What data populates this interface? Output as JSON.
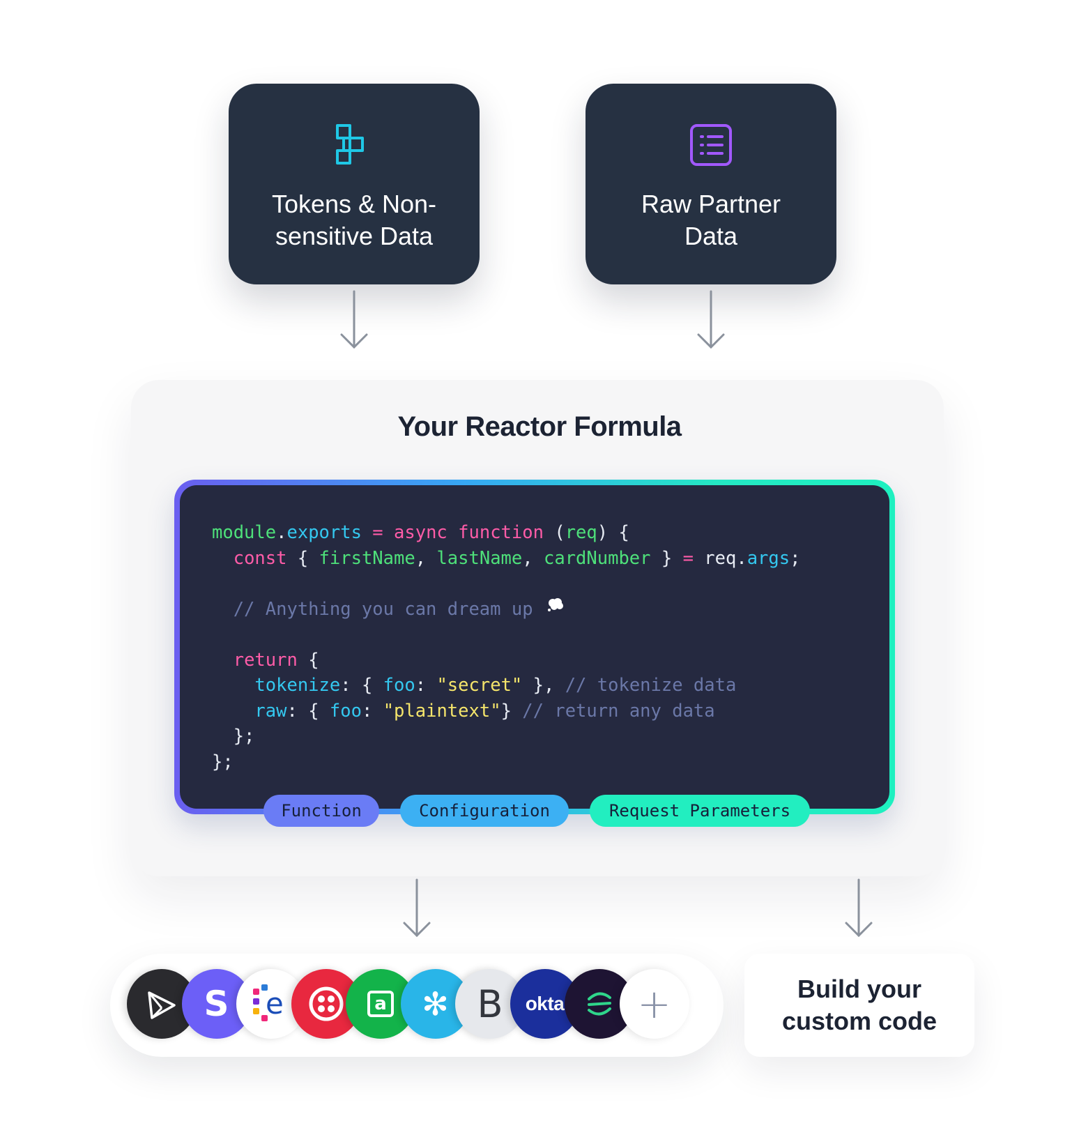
{
  "sources": {
    "tokens": {
      "title": "Tokens & Non-sensitive Data",
      "icon": "proxy-icon",
      "color": "#1fc8e6"
    },
    "raw": {
      "title": "Raw Partner Data",
      "icon": "list-icon",
      "color": "#a259ff"
    }
  },
  "formula": {
    "title": "Your Reactor Formula",
    "code": [
      [
        [
          "module",
          "g"
        ],
        [
          ".",
          "w"
        ],
        [
          "exports",
          "c"
        ],
        [
          " = ",
          "k"
        ],
        [
          "async",
          "k"
        ],
        [
          " ",
          "w"
        ],
        [
          "function",
          "k"
        ],
        [
          " (",
          "w"
        ],
        [
          "req",
          "g"
        ],
        [
          ") {",
          "w"
        ]
      ],
      [
        [
          "  ",
          "w"
        ],
        [
          "const",
          "k"
        ],
        [
          " { ",
          "w"
        ],
        [
          "firstName",
          "g"
        ],
        [
          ", ",
          "w"
        ],
        [
          "lastName",
          "g"
        ],
        [
          ", ",
          "w"
        ],
        [
          "cardNumber",
          "g"
        ],
        [
          " } ",
          "w"
        ],
        [
          "=",
          "k"
        ],
        [
          " req.",
          "w"
        ],
        [
          "args",
          "c"
        ],
        [
          ";",
          "w"
        ]
      ],
      [],
      [
        [
          "  // Anything you can dream up ",
          "cm"
        ]
      ],
      [],
      [
        [
          "  ",
          "w"
        ],
        [
          "return",
          "k"
        ],
        [
          " {",
          "w"
        ]
      ],
      [
        [
          "    ",
          "w"
        ],
        [
          "tokenize",
          "c"
        ],
        [
          ": { ",
          "w"
        ],
        [
          "foo",
          "c"
        ],
        [
          ": ",
          "w"
        ],
        [
          "\"secret\"",
          "s"
        ],
        [
          " }, ",
          "w"
        ],
        [
          "// tokenize data",
          "cm"
        ]
      ],
      [
        [
          "    ",
          "w"
        ],
        [
          "raw",
          "c"
        ],
        [
          ": { ",
          "w"
        ],
        [
          "foo",
          "c"
        ],
        [
          ": ",
          "w"
        ],
        [
          "\"plaintext\"",
          "s"
        ],
        [
          "} ",
          "w"
        ],
        [
          "// return any data",
          "cm"
        ]
      ],
      [
        [
          "  };",
          "w"
        ]
      ],
      [
        [
          "};",
          "w"
        ]
      ]
    ],
    "tags": [
      {
        "label": "Function",
        "color": "#6a7cf5"
      },
      {
        "label": "Configuration",
        "color": "#3cb0f3"
      },
      {
        "label": "Request Parameters",
        "color": "#22eec0"
      }
    ]
  },
  "integrations": {
    "logos": [
      {
        "name": "prisma-logo",
        "bg": "#2a2a2e",
        "text": ""
      },
      {
        "name": "stripe-logo",
        "bg": "#6c5ff7",
        "text": "S"
      },
      {
        "name": "elastic-logo",
        "bg": "#ffffff",
        "text": "e"
      },
      {
        "name": "twilio-logo",
        "bg": "#e8283f",
        "text": ""
      },
      {
        "name": "affirm-logo",
        "bg": "#13b34a",
        "text": "a"
      },
      {
        "name": "snowflake-logo",
        "bg": "#29b5e8",
        "text": "✻"
      },
      {
        "name": "bootstrap-logo",
        "bg": "#e6e8ec",
        "text": "B"
      },
      {
        "name": "okta-logo",
        "bg": "#1b2f9c",
        "text": "okta"
      },
      {
        "name": "sentry-logo",
        "bg": "#1e1433",
        "text": ""
      },
      {
        "name": "more-logo",
        "bg": "#ffffff",
        "text": "+"
      }
    ],
    "custom_code_label": "Build your custom code"
  }
}
